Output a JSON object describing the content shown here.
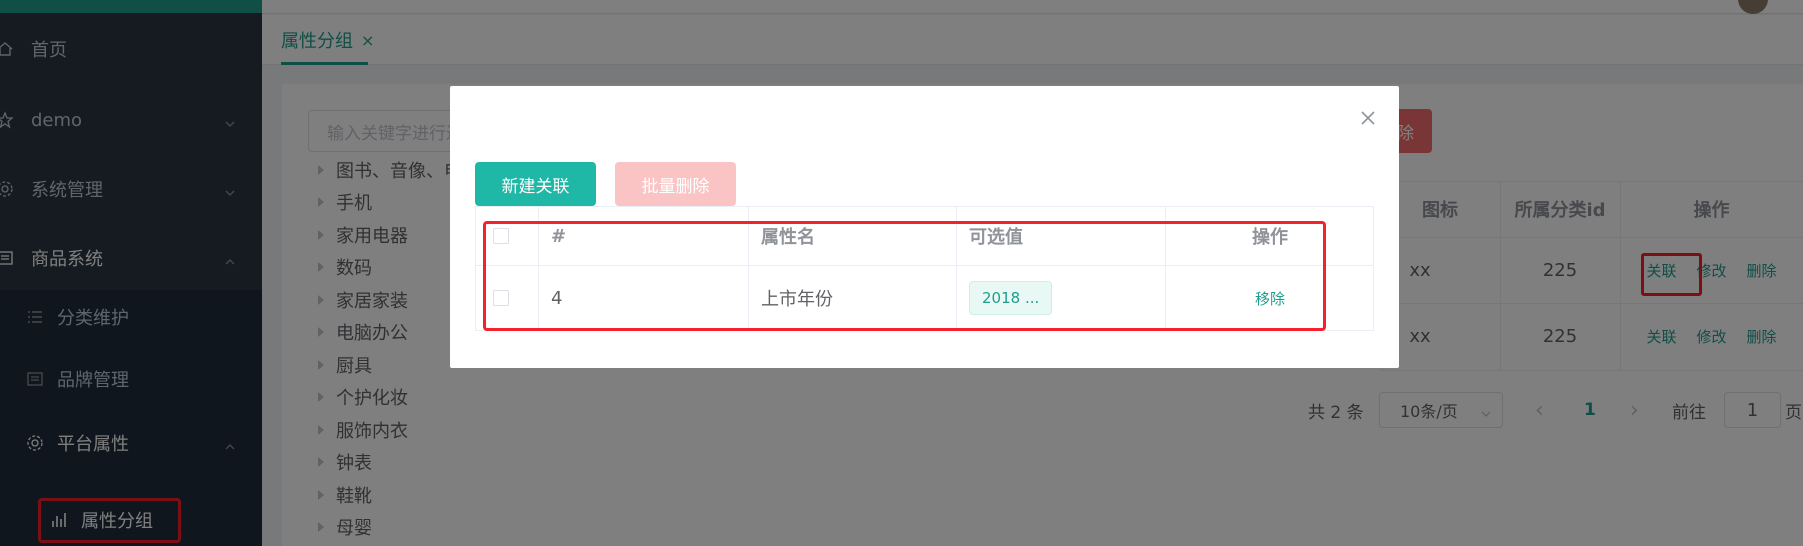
{
  "sidebar": {
    "items": [
      {
        "label": "首页",
        "icon": "home-icon"
      },
      {
        "label": "demo",
        "icon": "star-icon"
      },
      {
        "label": "系统管理",
        "icon": "gear-icon"
      },
      {
        "label": "商品系统",
        "icon": "product-icon"
      }
    ],
    "sub_items": [
      {
        "label": "分类维护",
        "icon": "list-icon"
      },
      {
        "label": "品牌管理",
        "icon": "brand-icon"
      },
      {
        "label": "平台属性",
        "icon": "gear-icon"
      },
      {
        "label": "属性分组",
        "icon": "bar-chart-icon"
      }
    ]
  },
  "tabs": [
    {
      "label": "属性分组",
      "close": "×"
    }
  ],
  "main": {
    "search_placeholder": "输入关键字进行过滤",
    "danger_button": "删除",
    "tree": [
      "图书、音像、电子书刊",
      "手机",
      "家用电器",
      "数码",
      "家居家装",
      "电脑办公",
      "厨具",
      "个护化妆",
      "服饰内衣",
      "钟表",
      "鞋靴",
      "母婴"
    ],
    "table": {
      "headers": [
        "图标",
        "所属分类id",
        "操作"
      ],
      "rows": [
        {
          "icon": "xx",
          "catelog_id": "225",
          "ops": [
            "关联",
            "修改",
            "删除"
          ]
        },
        {
          "icon": "xx",
          "catelog_id": "225",
          "ops": [
            "关联",
            "修改",
            "删除"
          ]
        }
      ]
    },
    "pager": {
      "total": "共 2 条",
      "page_size": "10条/页",
      "prev": "‹",
      "current": "1",
      "next": "›",
      "goto_label": "前往",
      "goto_value": "1",
      "page_suffix": "页"
    }
  },
  "dialog": {
    "close": "×",
    "new_button": "新建关联",
    "batch_delete_button": "批量删除",
    "headers": [
      "#",
      "属性名",
      "可选值",
      "操作"
    ],
    "rows": [
      {
        "id": "4",
        "name": "上市年份",
        "values": "2018 ...",
        "op": "移除"
      }
    ]
  },
  "colors": {
    "primary": "#1f9e8c",
    "sidebar": "#2b3740",
    "danger": "#f56c6c",
    "highlight": "#f5212d"
  }
}
